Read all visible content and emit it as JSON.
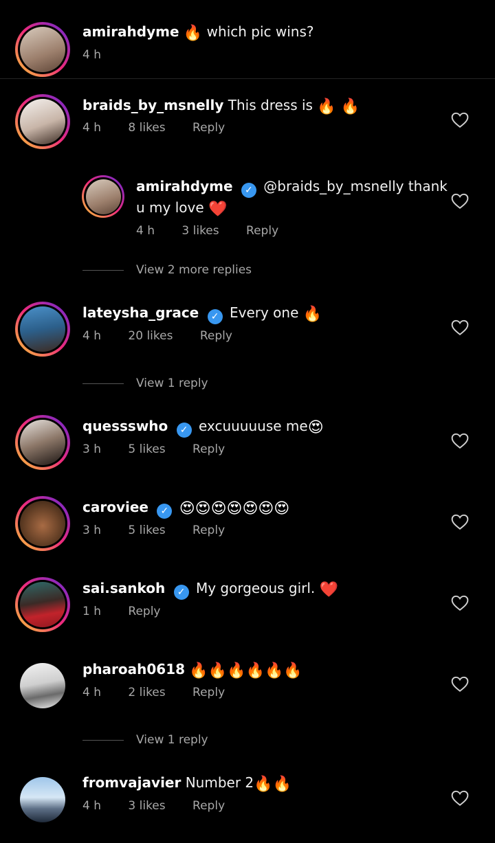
{
  "caption": {
    "username": "amirahdyme",
    "text": "which pic wins?",
    "emoji": "🔥",
    "time": "4 h"
  },
  "comments": [
    {
      "username": "braids_by_msnelly",
      "text": "This dress is",
      "emoji": "🔥 🔥",
      "time": "4 h",
      "likes": "8 likes",
      "reply": "Reply"
    },
    {
      "username": "amirahdyme",
      "mention": "@braids_by_msnelly thank",
      "text2": "u my love",
      "emoji": "❤️",
      "time": "4 h",
      "likes": "3 likes",
      "reply": "Reply"
    },
    {
      "view_replies": "View 2 more replies"
    },
    {
      "username": "lateysha_grace",
      "text": "Every one",
      "emoji": "🔥",
      "time": "4 h",
      "likes": "20 likes",
      "reply": "Reply"
    },
    {
      "view_replies": "View 1 reply"
    },
    {
      "username": "quessswho",
      "text": "excuuuuuse me",
      "emoji": "😍",
      "time": "3 h",
      "likes": "5 likes",
      "reply": "Reply"
    },
    {
      "username": "caroviee",
      "text": "",
      "emoji": "😍😍😍😍😍😍😍",
      "time": "3 h",
      "likes": "5 likes",
      "reply": "Reply"
    },
    {
      "username": "sai.sankoh",
      "text": "My gorgeous girl.",
      "emoji": "❤️",
      "time": "1 h",
      "reply": "Reply"
    },
    {
      "username": "pharoah0618",
      "text": "",
      "emoji": "🔥🔥🔥🔥🔥🔥",
      "time": "4 h",
      "likes": "2 likes",
      "reply": "Reply"
    },
    {
      "view_replies": "View 1 reply"
    },
    {
      "username": "fromvajavier",
      "text": "Number 2",
      "emoji": "🔥🔥",
      "time": "4 h",
      "likes": "3 likes",
      "reply": "Reply"
    }
  ],
  "colors": {
    "background": "#000000",
    "secondary_text": "#a8a8a8",
    "verified": "#3897f0",
    "ring_gradient": [
      "#f9ce34",
      "#ee2a7b",
      "#6228d7"
    ]
  },
  "icons": {
    "like": "heart-outline-icon",
    "verified": "verified-badge-icon"
  }
}
